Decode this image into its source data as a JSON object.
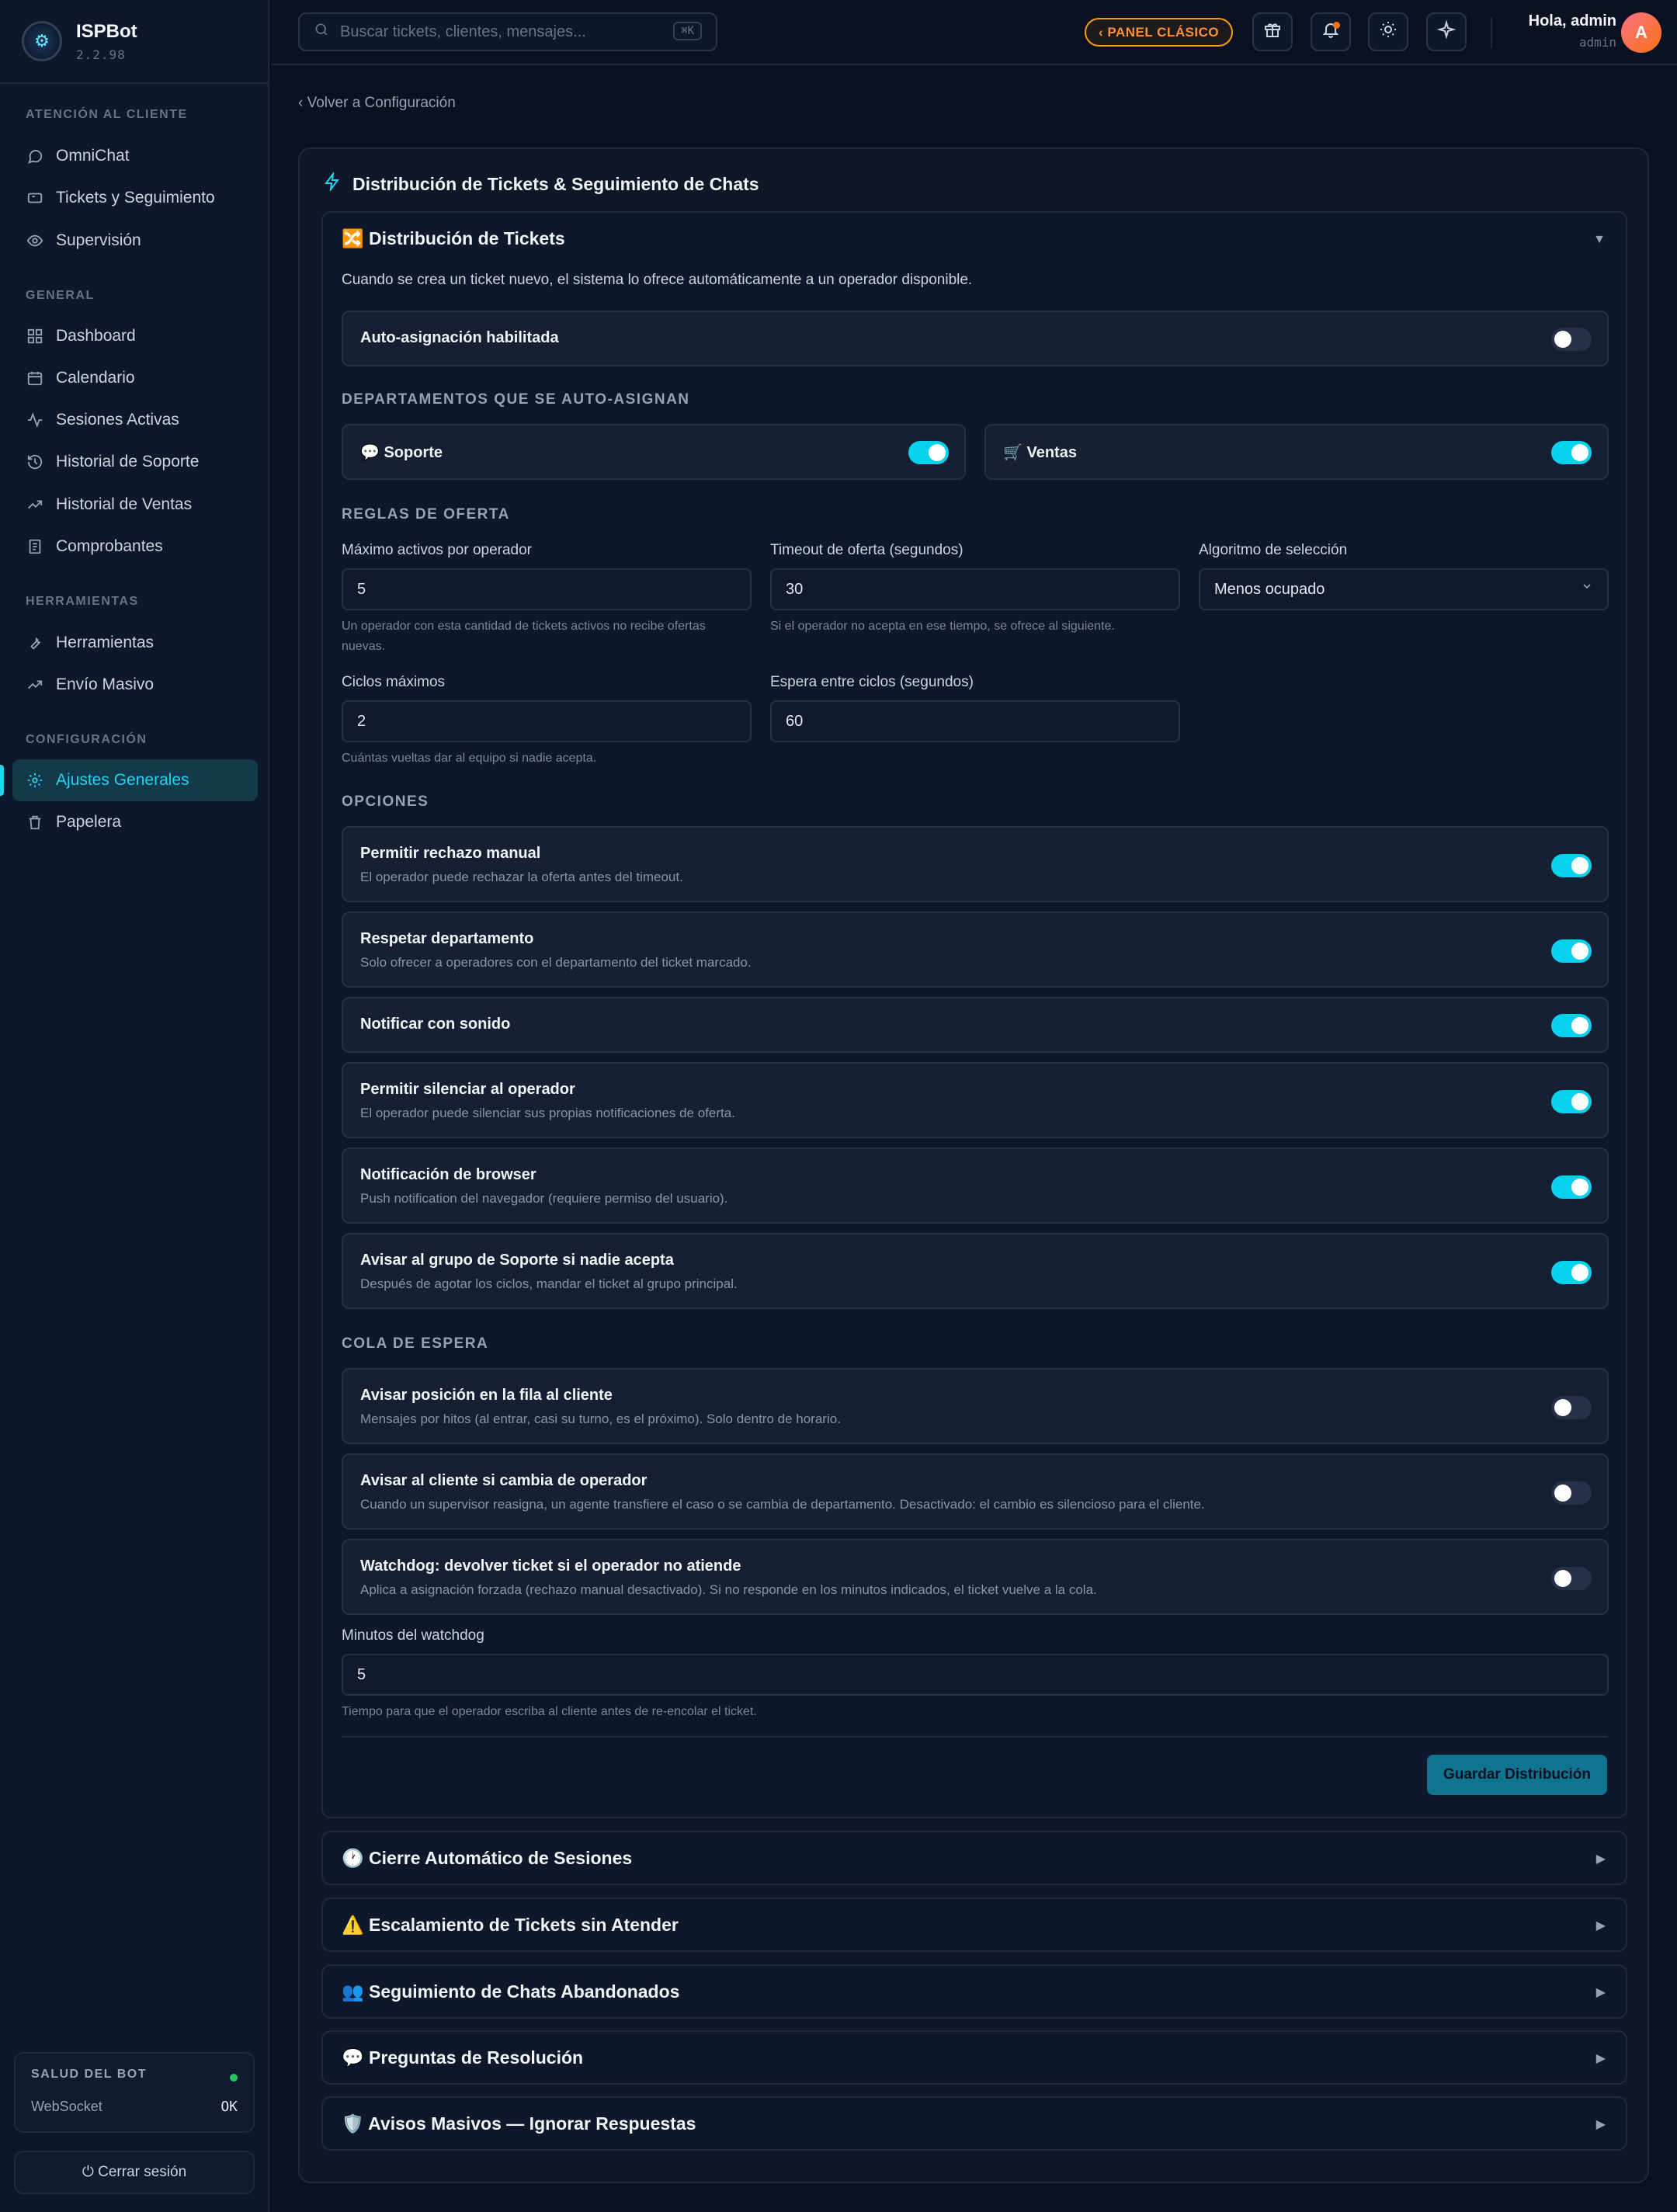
{
  "app": {
    "name": "ISPBot",
    "version": "2.2.98"
  },
  "sidebar": {
    "sections": [
      {
        "label": "ATENCIÓN AL CLIENTE",
        "items": [
          "OmniChat",
          "Tickets y Seguimiento",
          "Supervisión"
        ]
      },
      {
        "label": "GENERAL",
        "items": [
          "Dashboard",
          "Calendario",
          "Sesiones Activas",
          "Historial de Soporte",
          "Historial de Ventas",
          "Comprobantes"
        ]
      },
      {
        "label": "HERRAMIENTAS",
        "items": [
          "Herramientas",
          "Envío Masivo"
        ]
      },
      {
        "label": "CONFIGURACIÓN",
        "items": [
          "Ajustes Generales",
          "Papelera"
        ]
      }
    ],
    "active_item": "Ajustes Generales",
    "health": {
      "title": "SALUD DEL BOT",
      "label": "WebSocket",
      "value": "OK",
      "status_color": "#22c55e"
    },
    "logout": "⏻ Cerrar sesión"
  },
  "topbar": {
    "search_placeholder": "Buscar tickets, clientes, mensajes...",
    "search_shortcut": "⌘K",
    "classic_panel": "‹  PANEL CLÁSICO",
    "greeting": "Hola, admin",
    "username": "admin",
    "avatar_initial": "A"
  },
  "page": {
    "back_link": "‹ Volver a Configuración",
    "title": "Distribución de Tickets & Seguimiento de Chats"
  },
  "distribution": {
    "title": "🔀 Distribución de Tickets",
    "description": "Cuando se crea un ticket nuevo, el sistema lo ofrece automáticamente a un operador disponible.",
    "auto_assign": {
      "label": "Auto-asignación habilitada",
      "enabled": false
    },
    "departments_label": "DEPARTAMENTOS QUE SE AUTO-ASIGNAN",
    "departments": [
      {
        "label": "💬 Soporte",
        "enabled": true
      },
      {
        "label": "🛒 Ventas",
        "enabled": true
      }
    ],
    "rules_label": "REGLAS DE OFERTA",
    "rules": {
      "max_active": {
        "label": "Máximo activos por operador",
        "value": "5",
        "hint": "Un operador con esta cantidad de tickets activos no recibe ofertas nuevas."
      },
      "timeout": {
        "label": "Timeout de oferta (segundos)",
        "value": "30",
        "hint": "Si el operador no acepta en ese tiempo, se ofrece al siguiente."
      },
      "algorithm": {
        "label": "Algoritmo de selección",
        "value": "Menos ocupado"
      },
      "max_cycles": {
        "label": "Ciclos máximos",
        "value": "2",
        "hint": "Cuántas vueltas dar al equipo si nadie acepta."
      },
      "cycle_wait": {
        "label": "Espera entre ciclos (segundos)",
        "value": "60"
      }
    },
    "options_label": "OPCIONES",
    "options": [
      {
        "title": "Permitir rechazo manual",
        "sub": "El operador puede rechazar la oferta antes del timeout.",
        "enabled": true
      },
      {
        "title": "Respetar departamento",
        "sub": "Solo ofrecer a operadores con el departamento del ticket marcado.",
        "enabled": true
      },
      {
        "title": "Notificar con sonido",
        "sub": "",
        "enabled": true
      },
      {
        "title": "Permitir silenciar al operador",
        "sub": "El operador puede silenciar sus propias notificaciones de oferta.",
        "enabled": true
      },
      {
        "title": "Notificación de browser",
        "sub": "Push notification del navegador (requiere permiso del usuario).",
        "enabled": true
      },
      {
        "title": "Avisar al grupo de Soporte si nadie acepta",
        "sub": "Después de agotar los ciclos, mandar el ticket al grupo principal.",
        "enabled": true
      }
    ],
    "queue_label": "COLA DE ESPERA",
    "queue": [
      {
        "title": "Avisar posición en la fila al cliente",
        "sub": "Mensajes por hitos (al entrar, casi su turno, es el próximo). Solo dentro de horario.",
        "enabled": false
      },
      {
        "title": "Avisar al cliente si cambia de operador",
        "sub": "Cuando un supervisor reasigna, un agente transfiere el caso o se cambia de departamento. Desactivado: el cambio es silencioso para el cliente.",
        "enabled": false
      },
      {
        "title": "Watchdog: devolver ticket si el operador no atiende",
        "sub": "Aplica a asignación forzada (rechazo manual desactivado). Si no responde en los minutos indicados, el ticket vuelve a la cola.",
        "enabled": false
      }
    ],
    "watchdog": {
      "label": "Minutos del watchdog",
      "value": "5",
      "hint": "Tiempo para que el operador escriba al cliente antes de re-encolar el ticket."
    },
    "save": "Guardar Distribución"
  },
  "collapsed_sections": [
    "🕐 Cierre Automático de Sesiones",
    "⚠️ Escalamiento de Tickets sin Atender",
    "👥 Seguimiento de Chats Abandonados",
    "💬 Preguntas de Resolución",
    "🛡️ Avisos Masivos — Ignorar Respuestas"
  ],
  "colors": {
    "accent": "#22d3ee",
    "toggle_on": "#06d2ee",
    "classic": "#fb923c"
  }
}
